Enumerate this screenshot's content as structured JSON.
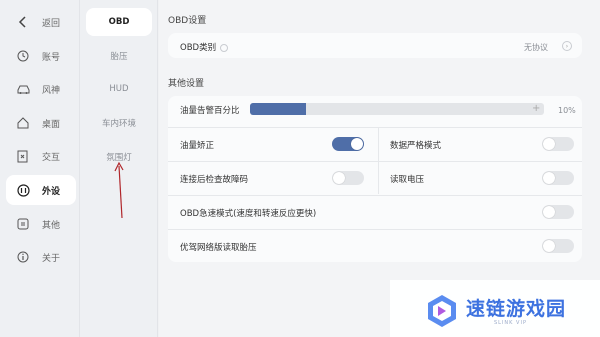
{
  "nav": {
    "back": "返回",
    "items": [
      {
        "label": "账号",
        "icon": "account-icon"
      },
      {
        "label": "风神",
        "icon": "car-icon"
      },
      {
        "label": "桌面",
        "icon": "home-icon"
      },
      {
        "label": "交互",
        "icon": "interaction-icon"
      },
      {
        "label": "外设",
        "icon": "peripheral-icon"
      },
      {
        "label": "其他",
        "icon": "other-icon"
      },
      {
        "label": "关于",
        "icon": "info-icon"
      }
    ],
    "active_index": 4
  },
  "subnav": {
    "items": [
      "OBD",
      "胎压",
      "HUD",
      "车内环境",
      "氛围灯"
    ],
    "active_index": 0
  },
  "obd_section": {
    "title": "OBD设置",
    "obd_type_label": "OBD类别",
    "obd_type_value": "无协议"
  },
  "other_section": {
    "title": "其他设置",
    "fuel_alert_label": "油量告警百分比",
    "fuel_alert_value": "10%",
    "fuel_alert_fraction": 0.19,
    "fuel_correct_label": "油量矫正",
    "fuel_correct_on": true,
    "strict_mode_label": "数据严格模式",
    "strict_mode_on": false,
    "fault_code_label": "连接后检查故障码",
    "fault_code_on": false,
    "read_voltage_label": "读取电压",
    "read_voltage_on": false,
    "fast_mode_label": "OBD急速模式(速度和转速反应更快)",
    "fast_mode_on": false,
    "priority_tire_label": "优驾网络版读取胎压",
    "priority_tire_on": false
  },
  "watermark": {
    "name": "速链游戏园",
    "sub": "SLINK VIP"
  },
  "colors": {
    "accent": "#4f6ea8",
    "watermark": "#3d72e0"
  }
}
